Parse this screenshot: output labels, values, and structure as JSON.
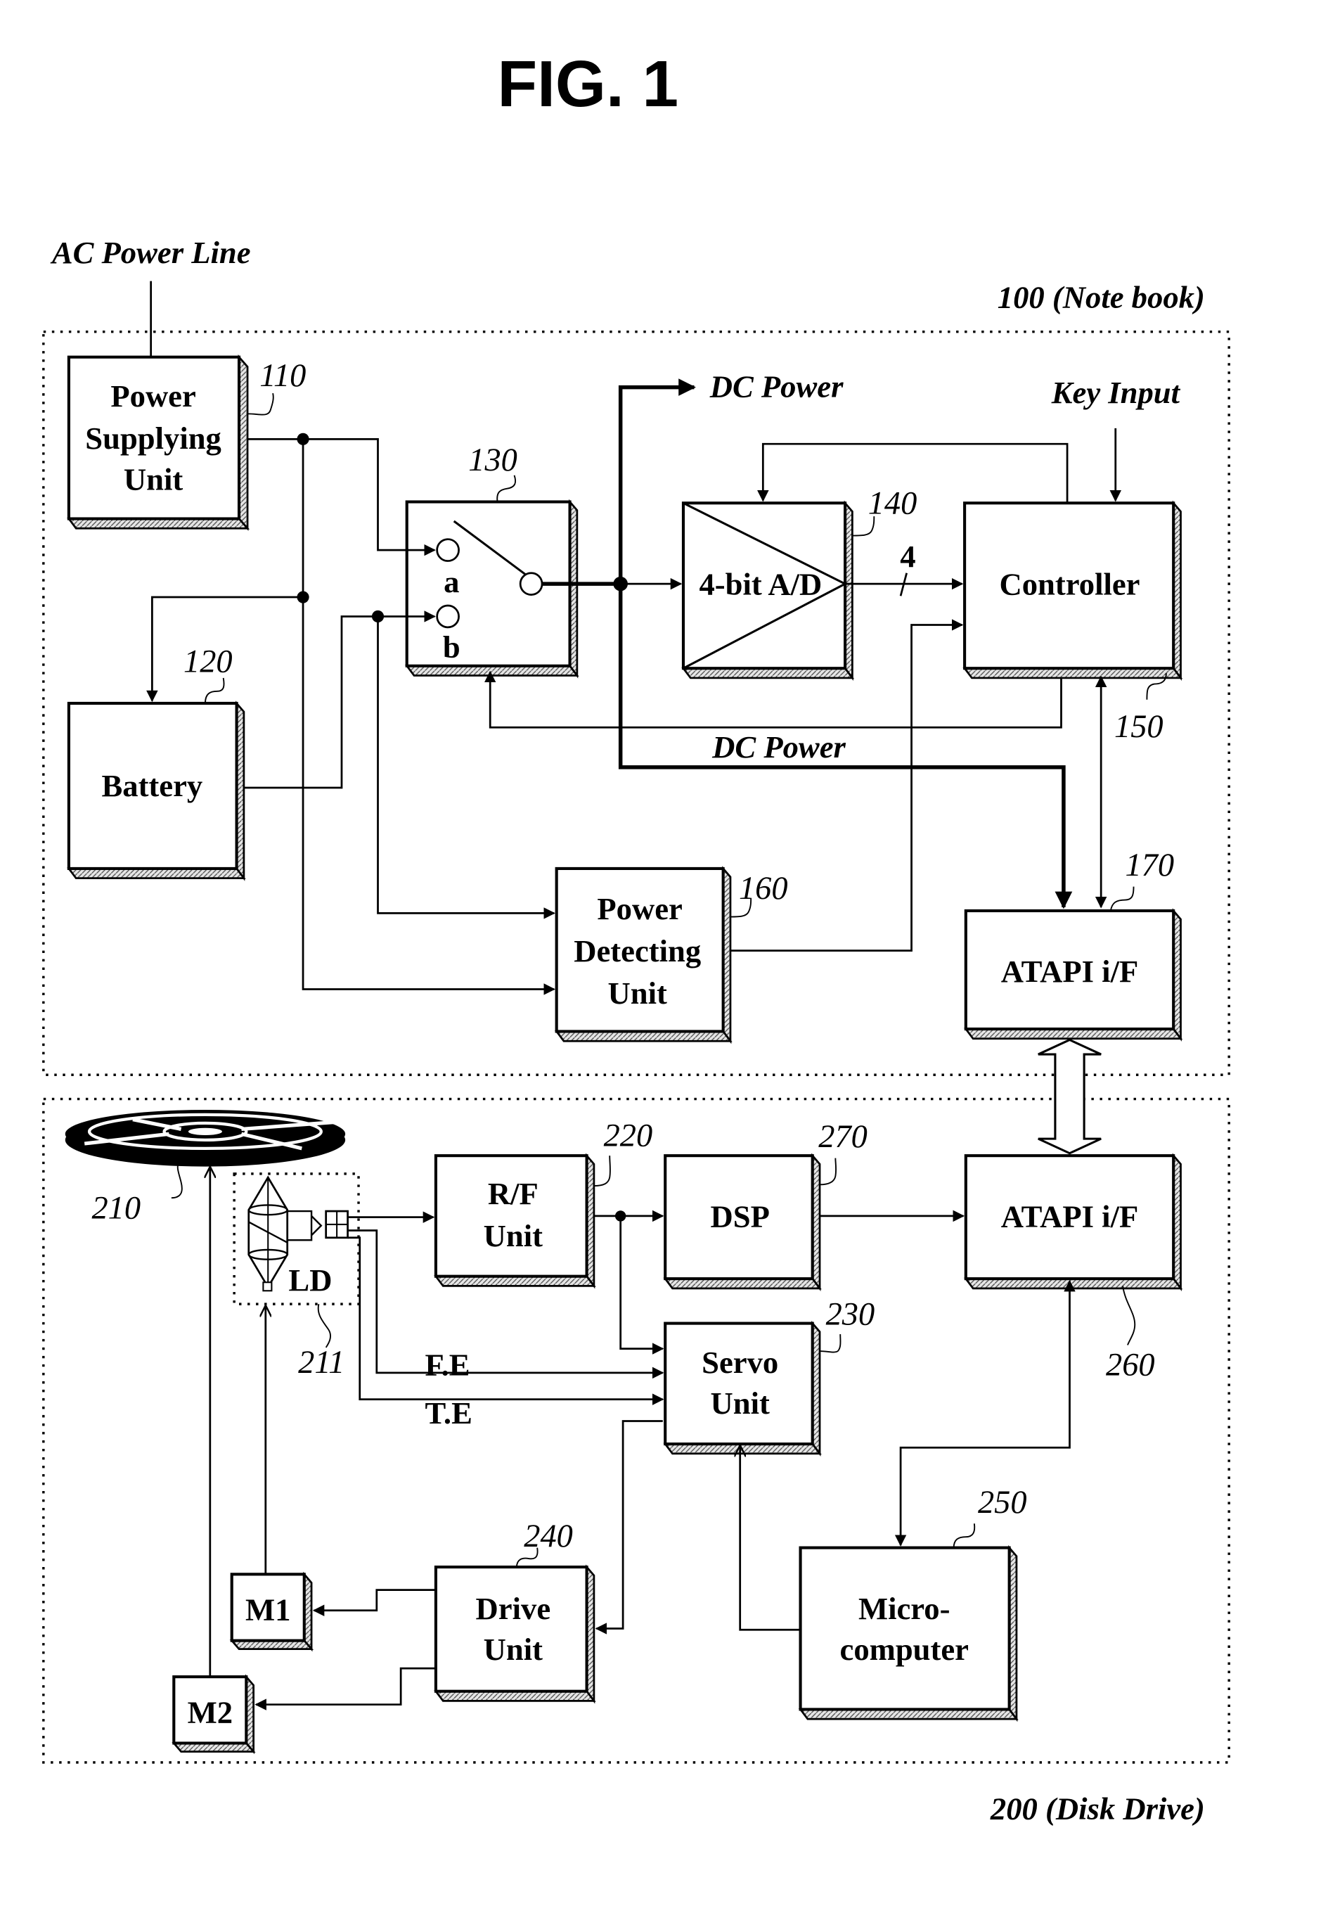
{
  "figure": {
    "title": "FIG. 1"
  },
  "groups": {
    "notebook": {
      "label": "100 (Note book)"
    },
    "disk_drive": {
      "label": "200 (Disk Drive)"
    }
  },
  "external_labels": {
    "ac_power_line": "AC Power Line",
    "dc_power_top": "DC Power",
    "dc_power_mid": "DC Power",
    "key_input": "Key Input",
    "bus_width": "4",
    "focus_error": "F.E",
    "tracking_error": "T.E",
    "laser_diode": "LD"
  },
  "blocks": {
    "power_supplying_unit": {
      "ref": "110",
      "lines": [
        "Power",
        "Supplying",
        "Unit"
      ]
    },
    "battery": {
      "ref": "120",
      "lines": [
        "Battery"
      ]
    },
    "switch": {
      "ref": "130",
      "terminal_a": "a",
      "terminal_b": "b"
    },
    "ad_converter": {
      "ref": "140",
      "lines": [
        "4-bit A/D"
      ]
    },
    "controller": {
      "ref": "150",
      "lines": [
        "Controller"
      ]
    },
    "power_detecting_unit": {
      "ref": "160",
      "lines": [
        "Power",
        "Detecting",
        "Unit"
      ]
    },
    "atapi_notebook": {
      "ref": "170",
      "lines": [
        "ATAPI i/F"
      ]
    },
    "disk": {
      "ref": "210"
    },
    "pickup": {
      "ref": "211"
    },
    "rf_unit": {
      "ref": "220",
      "lines": [
        "R/F",
        "Unit"
      ]
    },
    "servo_unit": {
      "ref": "230",
      "lines": [
        "Servo",
        "Unit"
      ]
    },
    "drive_unit": {
      "ref": "240",
      "lines": [
        "Drive",
        "Unit"
      ]
    },
    "microcomputer": {
      "ref": "250",
      "lines": [
        "Micro-",
        "computer"
      ]
    },
    "atapi_drive": {
      "ref": "260",
      "lines": [
        "ATAPI i/F"
      ]
    },
    "dsp": {
      "ref": "270",
      "lines": [
        "DSP"
      ]
    },
    "motor_1": {
      "lines": [
        "M1"
      ]
    },
    "motor_2": {
      "lines": [
        "M2"
      ]
    }
  }
}
